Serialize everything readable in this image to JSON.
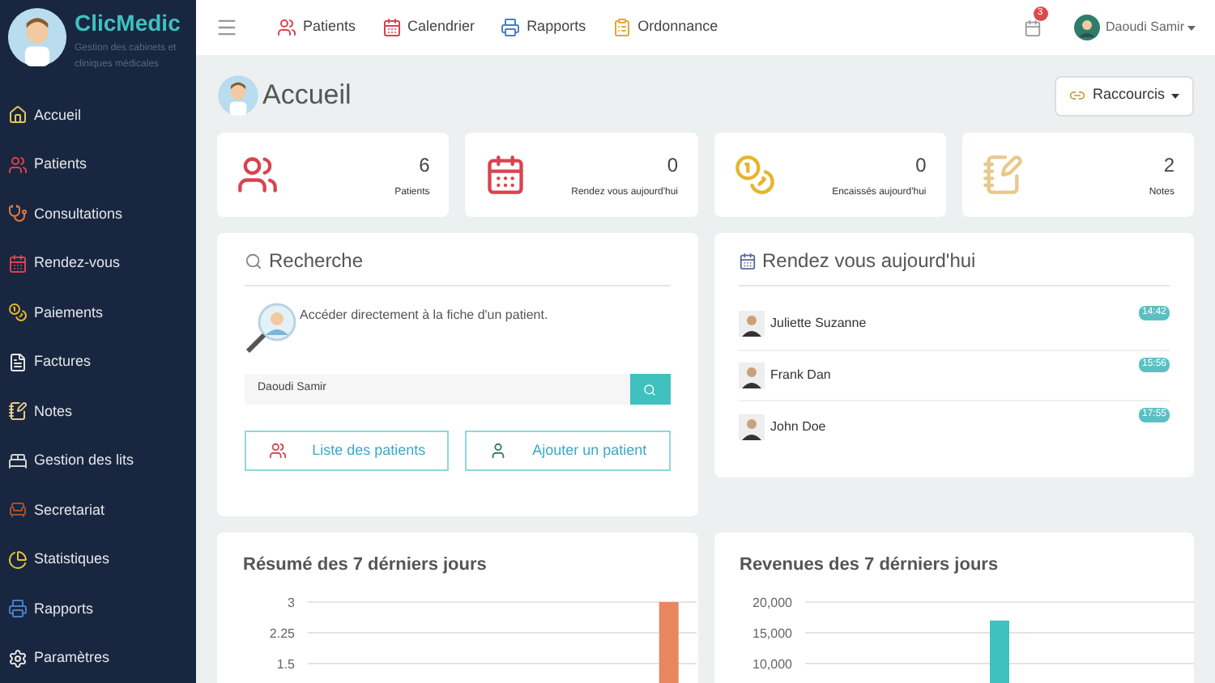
{
  "brand": {
    "name": "ClicMedic",
    "tagline": "Gestion des cabinets et cliniques médicales"
  },
  "sidebar": {
    "items": [
      {
        "label": "Accueil",
        "kind": "home"
      },
      {
        "label": "Patients",
        "kind": "users"
      },
      {
        "label": "Consultations",
        "kind": "stethoscope"
      },
      {
        "label": "Rendez-vous",
        "kind": "calendar"
      },
      {
        "label": "Paiements",
        "kind": "coins"
      },
      {
        "label": "Factures",
        "kind": "file"
      },
      {
        "label": "Notes",
        "kind": "notes"
      },
      {
        "label": "Gestion des lits",
        "kind": "bed"
      },
      {
        "label": "Secretariat",
        "kind": "desk"
      },
      {
        "label": "Statistiques",
        "kind": "chart"
      },
      {
        "label": "Rapports",
        "kind": "printer"
      },
      {
        "label": "Paramètres",
        "kind": "settings"
      }
    ]
  },
  "topbar": {
    "links": [
      {
        "label": "Patients",
        "kind": "users"
      },
      {
        "label": "Calendrier",
        "kind": "calendar"
      },
      {
        "label": "Rapports",
        "kind": "printer"
      },
      {
        "label": "Ordonnance",
        "kind": "prescription"
      }
    ],
    "notifications": "3",
    "user": "Daoudi Samir"
  },
  "page": {
    "title": "Accueil",
    "shortcuts_button": "Raccourcis"
  },
  "stats": [
    {
      "value": "6",
      "label": "Patients",
      "kind": "users"
    },
    {
      "value": "0",
      "label": "Rendez vous aujourd'hui",
      "kind": "calendar"
    },
    {
      "value": "0",
      "label": "Encaissés aujourd'hui",
      "kind": "coins"
    },
    {
      "value": "2",
      "label": "Notes",
      "kind": "notes"
    }
  ],
  "search": {
    "title": "Recherche",
    "description": "Accéder directement à la fiche d'un patient.",
    "value": "Daoudi Samir",
    "buttons": [
      {
        "label": "Liste des patients",
        "kind": "users"
      },
      {
        "label": "Ajouter un patient",
        "kind": "person"
      }
    ]
  },
  "appointments": {
    "title": "Rendez vous aujourd'hui",
    "items": [
      {
        "name": "Juliette Suzanne",
        "time": "14:42"
      },
      {
        "name": "Frank Dan",
        "time": "15:56"
      },
      {
        "name": "John Doe",
        "time": "17:55"
      }
    ]
  },
  "charts": [
    {
      "title": "Résumé des 7 dérniers jours",
      "chart_data": {
        "type": "bar",
        "values": [
          0,
          0,
          0,
          0,
          0,
          0,
          3
        ],
        "ylim": [
          0,
          3
        ],
        "yticks": [
          {
            "value": 1.5,
            "label": "1.5"
          },
          {
            "value": 2.25,
            "label": "2.25"
          },
          {
            "value": 3,
            "label": "3"
          }
        ],
        "color": "#e8875f"
      }
    },
    {
      "title": "Revenues des 7 dérniers jours",
      "chart_data": {
        "type": "bar",
        "values": [
          0,
          0,
          0,
          17000,
          0,
          0,
          0
        ],
        "ylim": [
          0,
          20000
        ],
        "yticks": [
          {
            "value": 10000,
            "label": "10,000"
          },
          {
            "value": 15000,
            "label": "15,000"
          },
          {
            "value": 20000,
            "label": "20,000"
          }
        ],
        "color": "#3fc1c0"
      }
    }
  ]
}
